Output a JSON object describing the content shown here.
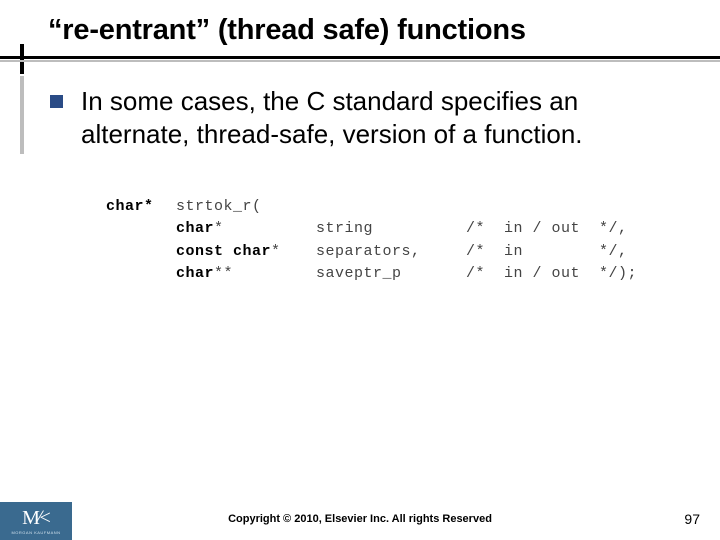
{
  "title": "“re-entrant” (thread safe) functions",
  "bullet": {
    "text": "In some cases, the C standard specifies an alternate, thread-safe, version of a function."
  },
  "code": {
    "ret": "char*",
    "fn": "strtok_r(",
    "rows": [
      {
        "type_kw": "char",
        "type_suffix": "*",
        "name": "string",
        "comment": "/*  in / out  */,"
      },
      {
        "type_kw": "const char",
        "type_suffix": "*",
        "name": "separators,",
        "comment": "/*  in        */,"
      },
      {
        "type_kw": "char",
        "type_suffix": "**",
        "name": "saveptr_p",
        "comment": "/*  in / out  */);"
      }
    ]
  },
  "footer": {
    "copyright": "Copyright © 2010, Elsevier Inc. All rights Reserved",
    "page": "97"
  },
  "logo": {
    "text": "M|K",
    "sub": "MORGAN KAUFMANN"
  }
}
